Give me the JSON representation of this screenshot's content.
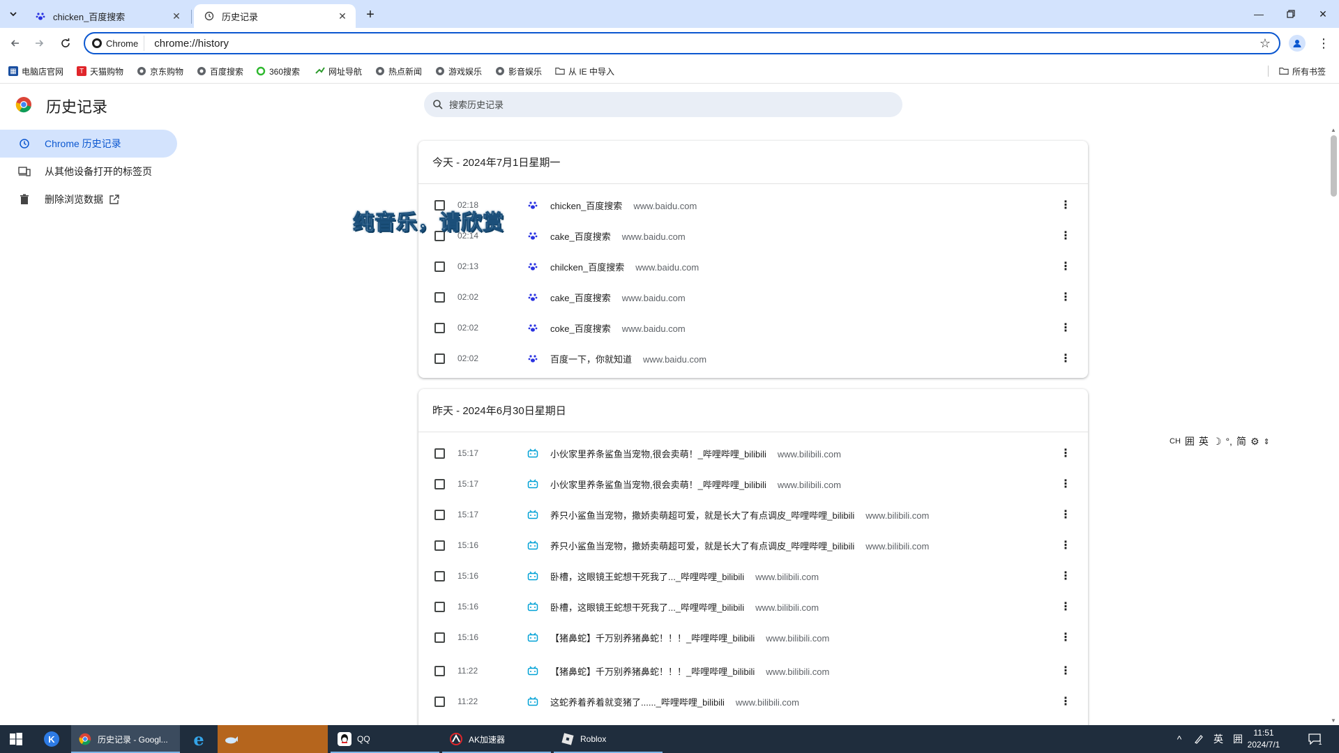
{
  "tabs": [
    {
      "title": "chicken_百度搜索",
      "icon": "baidu-paw-icon",
      "active": false
    },
    {
      "title": "历史记录",
      "icon": "history-icon",
      "active": true
    }
  ],
  "toolbar": {
    "chip_label": "Chrome",
    "url": "chrome://history"
  },
  "bookmarks": {
    "items": [
      {
        "label": "电脑店官网",
        "icon": "grid-icon",
        "color": "#1a4fa0"
      },
      {
        "label": "天猫购物",
        "icon": "tmall-icon",
        "color": "#e0262b"
      },
      {
        "label": "京东购物",
        "icon": "globe-icon",
        "color": "#5f6368"
      },
      {
        "label": "百度搜索",
        "icon": "globe-icon",
        "color": "#5f6368"
      },
      {
        "label": "360搜索",
        "icon": "360-icon",
        "color": "#2eb82e"
      },
      {
        "label": "网址导航",
        "icon": "nav-icon",
        "color": "#2e9b2e"
      },
      {
        "label": "热点新闻",
        "icon": "globe-icon",
        "color": "#5f6368"
      },
      {
        "label": "游戏娱乐",
        "icon": "globe-icon",
        "color": "#5f6368"
      },
      {
        "label": "影音娱乐",
        "icon": "globe-icon",
        "color": "#5f6368"
      },
      {
        "label": "从 IE 中导入",
        "icon": "folder-icon",
        "color": "#5f6368"
      }
    ],
    "all_bookmarks": "所有书签"
  },
  "page": {
    "title": "历史记录",
    "search_placeholder": "搜索历史记录"
  },
  "sidebar": {
    "items": [
      {
        "label": "Chrome 历史记录",
        "icon": "history-icon",
        "selected": true
      },
      {
        "label": "从其他设备打开的标签页",
        "icon": "devices-icon",
        "selected": false
      },
      {
        "label": "删除浏览数据",
        "icon": "trash-icon",
        "selected": false
      }
    ]
  },
  "groups": [
    {
      "header": "今天 - 2024年7月1日星期一",
      "rows": [
        {
          "time": "02:18",
          "title": "chicken_百度搜索",
          "domain": "www.baidu.com",
          "icon": "baidu"
        },
        {
          "time": "02:14",
          "title": "cake_百度搜索",
          "domain": "www.baidu.com",
          "icon": "baidu"
        },
        {
          "time": "02:13",
          "title": "chilcken_百度搜索",
          "domain": "www.baidu.com",
          "icon": "baidu"
        },
        {
          "time": "02:02",
          "title": "cake_百度搜索",
          "domain": "www.baidu.com",
          "icon": "baidu"
        },
        {
          "time": "02:02",
          "title": "coke_百度搜索",
          "domain": "www.baidu.com",
          "icon": "baidu"
        },
        {
          "time": "02:02",
          "title": "百度一下，你就知道",
          "domain": "www.baidu.com",
          "icon": "baidu"
        }
      ]
    },
    {
      "header": "昨天 - 2024年6月30日星期日",
      "rows": [
        {
          "time": "15:17",
          "title": "小伙家里养条鲨鱼当宠物,很会卖萌！_哔哩哔哩_bilibili",
          "domain": "www.bilibili.com",
          "icon": "bilibili"
        },
        {
          "time": "15:17",
          "title": "小伙家里养条鲨鱼当宠物,很会卖萌！_哔哩哔哩_bilibili",
          "domain": "www.bilibili.com",
          "icon": "bilibili"
        },
        {
          "time": "15:17",
          "title": "养只小鲨鱼当宠物，撒娇卖萌超可爱，就是长大了有点调皮_哔哩哔哩_bilibili",
          "domain": "www.bilibili.com",
          "icon": "bilibili"
        },
        {
          "time": "15:16",
          "title": "养只小鲨鱼当宠物，撒娇卖萌超可爱，就是长大了有点调皮_哔哩哔哩_bilibili",
          "domain": "www.bilibili.com",
          "icon": "bilibili"
        },
        {
          "time": "15:16",
          "title": "卧槽，这眼镜王蛇想干死我了..._哔哩哔哩_bilibili",
          "domain": "www.bilibili.com",
          "icon": "bilibili"
        },
        {
          "time": "15:16",
          "title": "卧槽，这眼镜王蛇想干死我了..._哔哩哔哩_bilibili",
          "domain": "www.bilibili.com",
          "icon": "bilibili"
        },
        {
          "time": "15:16",
          "title": "【猪鼻蛇】千万别养猪鼻蛇！！！_哔哩哔哩_bilibili",
          "domain": "www.bilibili.com",
          "icon": "bilibili"
        },
        {
          "time": "11:22",
          "title": "【猪鼻蛇】千万别养猪鼻蛇！！！_哔哩哔哩_bilibili",
          "domain": "www.bilibili.com",
          "icon": "bilibili"
        },
        {
          "time": "11:22",
          "title": "这蛇养着养着就变猪了......_哔哩哔哩_bilibili",
          "domain": "www.bilibili.com",
          "icon": "bilibili"
        }
      ]
    }
  ],
  "overlay": {
    "text": "纯音乐，请欣赏"
  },
  "ime": {
    "items": [
      "CH",
      "囲",
      "英",
      "☽",
      "°,",
      "简",
      "⚙",
      "⇕"
    ]
  },
  "taskbar": {
    "apps": [
      {
        "label": "",
        "icon": "windows-start-icon"
      },
      {
        "label": "",
        "icon": "k-app-icon"
      },
      {
        "label": "历史记录 - Googl...",
        "icon": "chrome-icon"
      },
      {
        "label": "",
        "icon": "ie-icon"
      },
      {
        "label": "",
        "icon": "whale-app-icon"
      },
      {
        "label": "QQ",
        "icon": "qq-icon"
      },
      {
        "label": "AK加速器",
        "icon": "ak-icon"
      },
      {
        "label": "Roblox",
        "icon": "roblox-icon"
      }
    ],
    "tray": {
      "ime": "英",
      "ime2": "囲"
    },
    "time": "11:51",
    "date": "2024/7/1",
    "notifications": "1"
  },
  "colors": {
    "accent": "#0b57d0",
    "tabstrip": "#d3e3fd",
    "baidu": "#2932e1",
    "bilibili": "#00a1d6",
    "taskbar": "#1f2d3d"
  }
}
